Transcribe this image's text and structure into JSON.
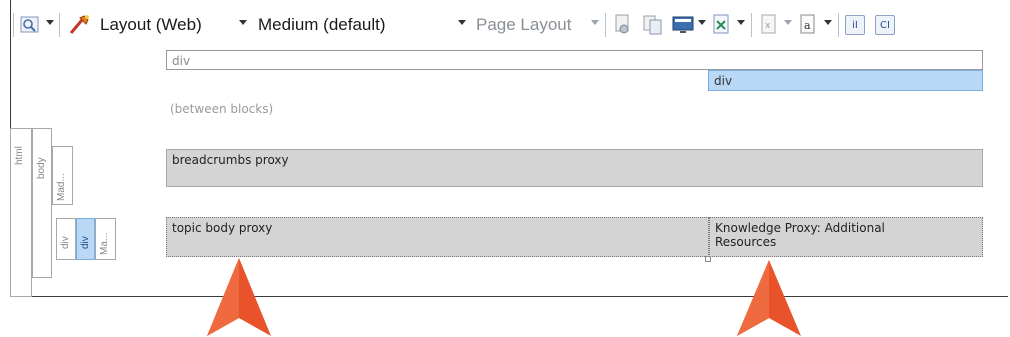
{
  "toolbar": {
    "layout_dropdown": "Layout (Web)",
    "medium_dropdown": "Medium (default)",
    "page_layout_dropdown": "Page Layout",
    "icons": [
      "view-icon",
      "style-wand-icon",
      "preview-icon",
      "copy-layout-icon",
      "monitor-icon",
      "xml-icon",
      "variable-icon",
      "text-format-icon",
      "ii-icon",
      "ci-icon"
    ]
  },
  "structure": {
    "html": "html",
    "body": "body",
    "mad": "Mad...",
    "div1": "div",
    "div2": "div",
    "ma": "Ma..."
  },
  "blocks": {
    "top_div": "div",
    "right_div": "div",
    "between": "(between blocks)",
    "breadcrumbs": "breadcrumbs proxy",
    "topic_body": "topic body proxy",
    "knowledge": "Knowledge Proxy: Additional Resources"
  },
  "colors": {
    "arrow": "#e8532b",
    "selected_div": "#b8d8f6",
    "proxy_fill": "#d4d4d4"
  }
}
